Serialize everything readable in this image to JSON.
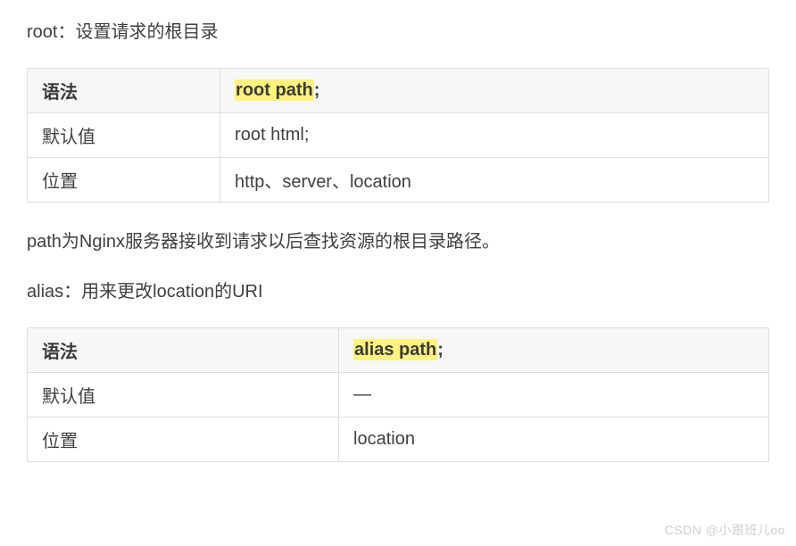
{
  "intro1": "root：设置请求的根目录",
  "table1": {
    "header": {
      "col1": "语法",
      "col2_highlight": "root path",
      "col2_suffix": ";"
    },
    "row1": {
      "col1": "默认值",
      "col2": "root html;"
    },
    "row2": {
      "col1": "位置",
      "col2": "http、server、location"
    }
  },
  "desc2": "path为Nginx服务器接收到请求以后查找资源的根目录路径。",
  "intro2": "alias：用来更改location的URI",
  "table2": {
    "header": {
      "col1": "语法",
      "col2_highlight": "alias path",
      "col2_suffix": ";"
    },
    "row1": {
      "col1": "默认值",
      "col2": "—"
    },
    "row2": {
      "col1": "位置",
      "col2": "location"
    }
  },
  "watermark": "CSDN @小跟班儿oo"
}
